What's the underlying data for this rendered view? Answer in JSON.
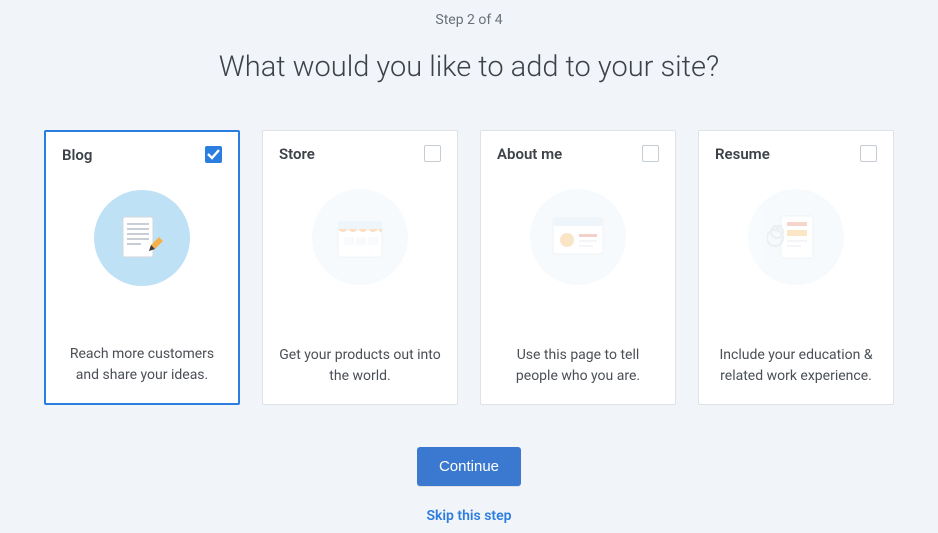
{
  "step_label": "Step 2 of 4",
  "headline": "What would you like to add to your site?",
  "continue_label": "Continue",
  "skip_label": "Skip this step",
  "cards": {
    "blog": {
      "title": "Blog",
      "desc": "Reach more customers and share your ideas.",
      "selected": true
    },
    "store": {
      "title": "Store",
      "desc": "Get your products out into the world.",
      "selected": false
    },
    "about": {
      "title": "About me",
      "desc": "Use this page to tell people who you are.",
      "selected": false
    },
    "resume": {
      "title": "Resume",
      "desc": "Include your education & related work experience.",
      "selected": false
    }
  }
}
